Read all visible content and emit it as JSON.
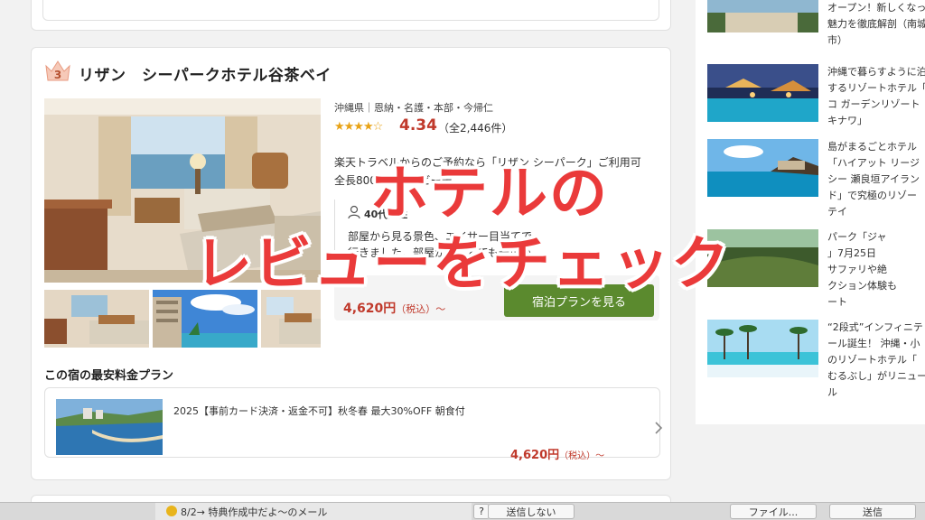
{
  "hotel": {
    "rank": "3",
    "name": "リザン　シーパークホテル谷茶ベイ",
    "location": "沖縄県｜恩納・名護・本部・今帰仁",
    "stars": "★★★★☆",
    "rating": "4.34",
    "review_count": "（全2,446件）",
    "description_line1": "楽天トラベルからのご予約なら「リザン シーパーク」ご利用可",
    "description_line2": "全長800mの天然ビーチ",
    "reviewer": "40代女性",
    "review_line1": "部屋から見る景色、エイサー目当てで",
    "review_line2": "行きました。部屋からはとても景色が",
    "price": "4,620円",
    "price_tax": "（税込）～",
    "plan_button": "宿泊プランを見る"
  },
  "cheapest": {
    "title": "この宿の最安料金プラン",
    "plan_name": "2025【事前カード決済・返金不可】秋冬春 最大30%OFF 朝食付",
    "price": "4,620円",
    "price_tax": "（税込）～"
  },
  "sidebar": {
    "items": [
      {
        "lines": [
          "オープン！新しくなっ",
          "魅力を徹底解剖（南城",
          "市）"
        ]
      },
      {
        "lines": [
          "沖縄で暮らすように泊",
          "するリゾートホテル「",
          "コ ガーデンリゾート",
          "キナワ」"
        ]
      },
      {
        "lines": [
          "島がまるごとホテル",
          "「ハイアット リージ",
          "シー 瀬良垣アイラン",
          "ド」で究極のリゾー",
          "テイ"
        ]
      },
      {
        "lines": [
          "パーク「ジャ",
          "」7月25日",
          "サファリや絶",
          "クション体験も",
          "ート"
        ]
      },
      {
        "lines": [
          "“2段式”インフィニテ",
          "ール誕生！ 沖縄・小",
          "のリゾートホテル「",
          "むるぶし」がリニュー",
          "ル"
        ]
      }
    ]
  },
  "overlay": {
    "line1": "ホテルの",
    "line2": "レビューをチェック"
  },
  "mailbar": {
    "notice": "8/2→ 特典作成中だよ～のメール",
    "help": "?",
    "dont_send": "送信しない",
    "file": "ファイル...",
    "send": "送信"
  },
  "colors": {
    "accent_red": "#c0392b",
    "overlay_red": "#ea3a3a",
    "button_green": "#5b8a2e",
    "star_gold": "#e8a317"
  }
}
